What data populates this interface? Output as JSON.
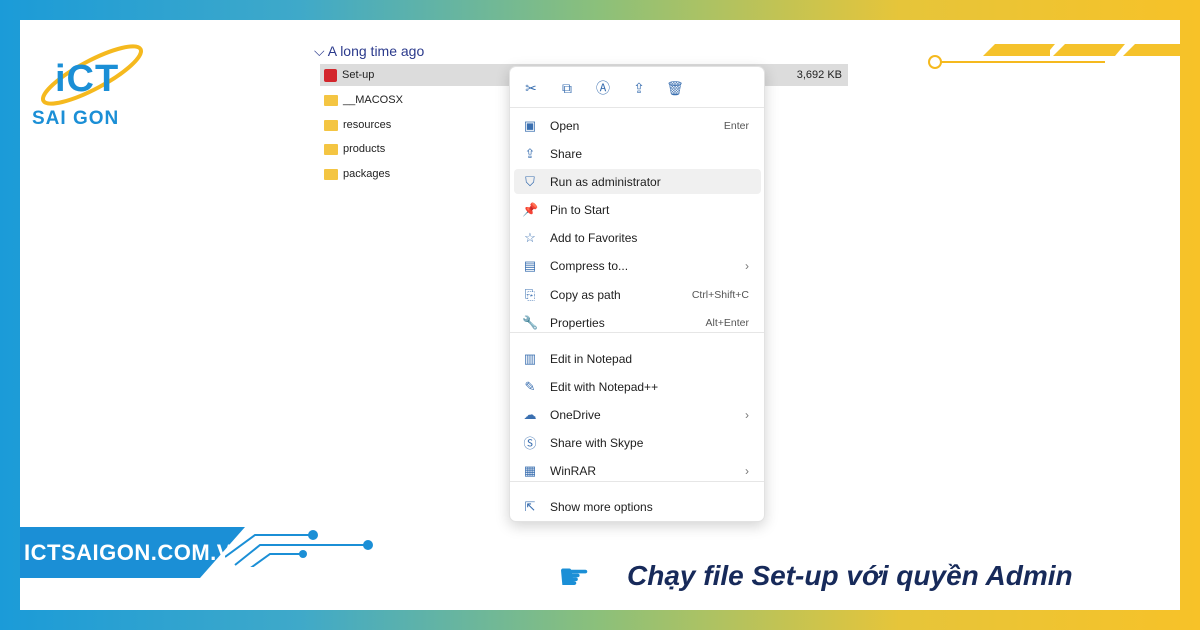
{
  "brand": {
    "logo_text": "iCT",
    "logo_sub": "SAI GON",
    "website": "ICTSAIGON.COM.VN"
  },
  "explorer": {
    "group": "A long time ago",
    "files": [
      {
        "name": "Set-up",
        "size": "3,692 KB",
        "type": "app"
      },
      {
        "name": "__MACOSX",
        "type": "folder"
      },
      {
        "name": "resources",
        "type": "folder"
      },
      {
        "name": "products",
        "type": "folder"
      },
      {
        "name": "packages",
        "type": "folder"
      }
    ]
  },
  "menu": {
    "toolbar": [
      "cut-icon",
      "copy-icon",
      "rename-icon",
      "share-icon",
      "delete-icon"
    ],
    "items": [
      {
        "label": "Open",
        "shortcut": "Enter",
        "icon": "open-icon"
      },
      {
        "label": "Share",
        "icon": "share-icon"
      },
      {
        "label": "Run as administrator",
        "icon": "shield-icon",
        "highlighted": true
      },
      {
        "label": "Pin to Start",
        "icon": "pin-icon"
      },
      {
        "label": "Add to Favorites",
        "icon": "star-icon"
      },
      {
        "label": "Compress to...",
        "icon": "zip-icon",
        "submenu": true
      },
      {
        "label": "Copy as path",
        "shortcut": "Ctrl+Shift+C",
        "icon": "path-icon"
      },
      {
        "label": "Properties",
        "shortcut": "Alt+Enter",
        "icon": "wrench-icon"
      },
      {
        "label": "Edit in Notepad",
        "icon": "notepad-icon"
      },
      {
        "label": "Edit with Notepad++",
        "icon": "notepadpp-icon"
      },
      {
        "label": "OneDrive",
        "icon": "onedrive-icon",
        "submenu": true
      },
      {
        "label": "Share with Skype",
        "icon": "skype-icon"
      },
      {
        "label": "WinRAR",
        "icon": "winrar-icon",
        "submenu": true
      },
      {
        "label": "Show more options",
        "icon": "more-options-icon"
      }
    ]
  },
  "caption": "Chạy file Set-up với quyền Admin",
  "colors": {
    "brand_blue": "#1b8fd6",
    "brand_yellow": "#f7c228",
    "caption": "#172a5a"
  }
}
